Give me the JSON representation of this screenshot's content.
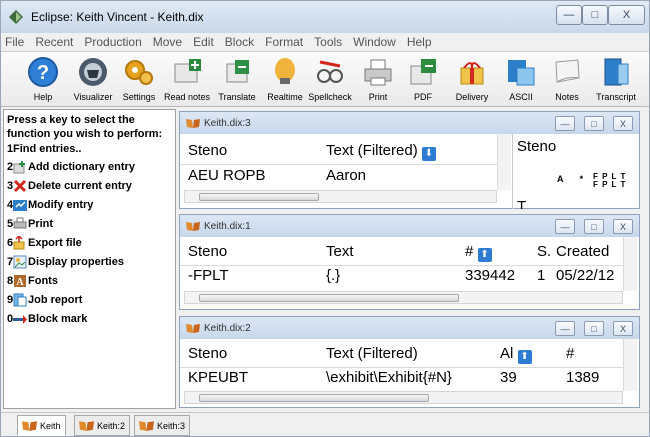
{
  "window": {
    "title": "Eclipse: Keith Vincent - Keith.dix",
    "min_glyph": "—",
    "max_glyph": "□",
    "close_glyph": "X"
  },
  "menu": [
    "File",
    "Recent",
    "Production",
    "Move",
    "Edit",
    "Block",
    "Format",
    "Tools",
    "Window",
    "Help"
  ],
  "toolbar": [
    {
      "label": "Help",
      "icon": "help-icon"
    },
    {
      "label": "Visualizer",
      "icon": "visualizer-icon"
    },
    {
      "label": "Settings",
      "icon": "settings-icon"
    },
    {
      "label": "Read notes",
      "icon": "read-notes-icon"
    },
    {
      "label": "Translate",
      "icon": "translate-icon"
    },
    {
      "label": "Realtime",
      "icon": "realtime-icon"
    },
    {
      "label": "Spellcheck",
      "icon": "spellcheck-icon"
    },
    {
      "label": "Print",
      "icon": "print-icon"
    },
    {
      "label": "PDF",
      "icon": "pdf-icon"
    },
    {
      "label": "Delivery",
      "icon": "delivery-icon"
    },
    {
      "label": "ASCII",
      "icon": "ascii-icon"
    },
    {
      "label": "Notes",
      "icon": "notes-icon"
    },
    {
      "label": "Transcript",
      "icon": "transcript-icon"
    }
  ],
  "leftpanel": {
    "intro": "Press a key to select the function you wish to perform:",
    "items": [
      {
        "key": "1",
        "label": "Find entries..",
        "icon": ""
      },
      {
        "key": "2",
        "label": "Add dictionary entry",
        "icon": "add-icon"
      },
      {
        "key": "3",
        "label": "Delete current entry",
        "icon": "delete-icon"
      },
      {
        "key": "4",
        "label": "Modify entry",
        "icon": "modify-icon"
      },
      {
        "key": "5",
        "label": "Print",
        "icon": "print-icon"
      },
      {
        "key": "6",
        "label": "Export file",
        "icon": "export-icon"
      },
      {
        "key": "7",
        "label": "Display properties",
        "icon": "display-icon"
      },
      {
        "key": "8",
        "label": "Fonts",
        "icon": "fonts-icon"
      },
      {
        "key": "9",
        "label": "Job report",
        "icon": "report-icon"
      },
      {
        "key": "0",
        "label": "Block mark",
        "icon": "block-mark-icon"
      }
    ]
  },
  "windows": [
    {
      "title": "Keith.dix:3",
      "headers": [
        "Steno",
        "Text (Filtered)"
      ],
      "row": [
        "AEU ROPB",
        "Aaron"
      ],
      "sort_glyph": "⬇",
      "preview_title": "Steno",
      "preview_keys_top": "F P L T",
      "preview_keys_bottom": "F P L T",
      "preview_vowels": "A *",
      "preview_cut": "T"
    },
    {
      "title": "Keith.dix:1",
      "headers": [
        "Steno",
        "Text",
        "#",
        "S.",
        "Created"
      ],
      "row": [
        "-FPLT",
        "{.}",
        "339442",
        "1",
        "05/22/12"
      ],
      "sort_glyph": "⬆"
    },
    {
      "title": "Keith.dix:2",
      "headers": [
        "Steno",
        "Text (Filtered)",
        "Al",
        "#"
      ],
      "row": [
        "KPEUBT",
        "\\exhibit\\Exhibit{#N}",
        "39",
        "1389"
      ],
      "sort_glyph": "⬆"
    }
  ],
  "tabs": [
    "Keith",
    "Keith:2",
    "Keith:3"
  ]
}
